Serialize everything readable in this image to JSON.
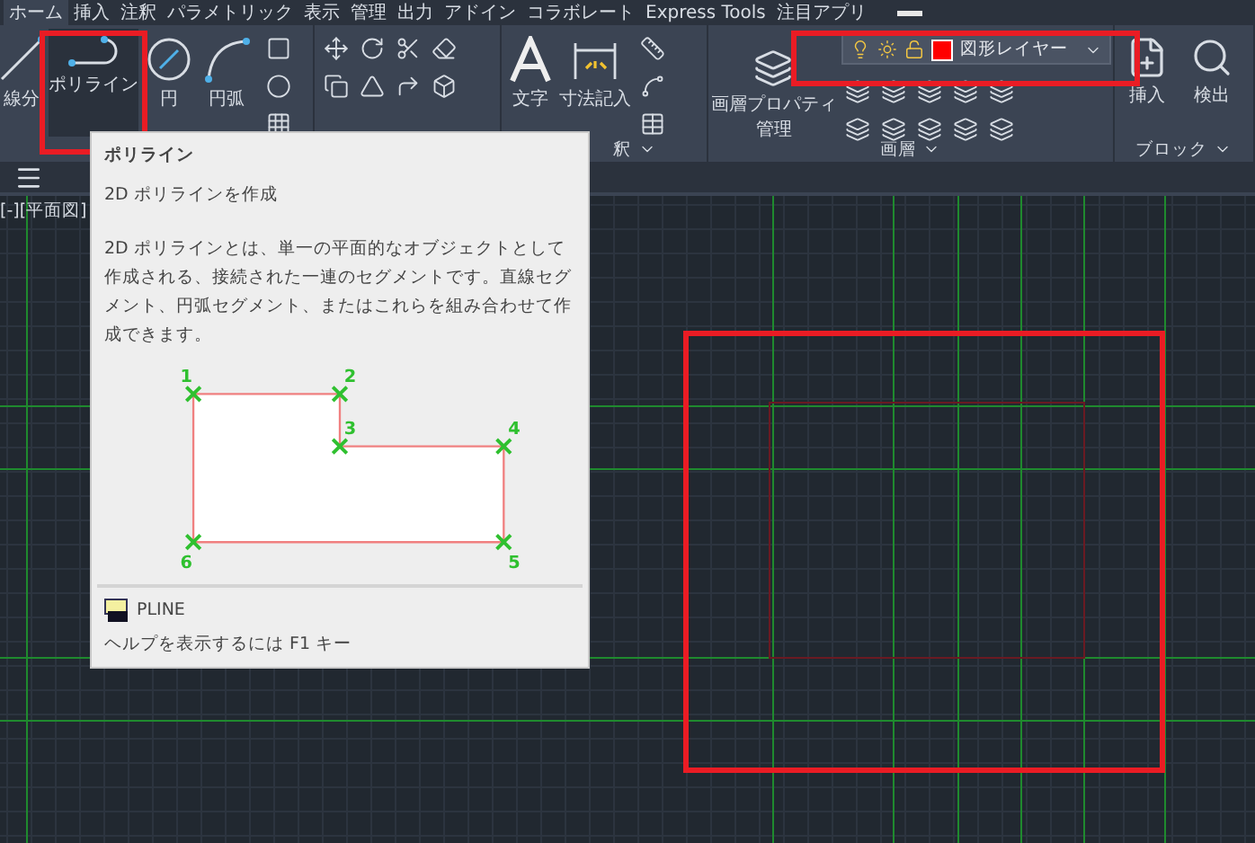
{
  "ribbon_tabs": [
    {
      "label": "ホーム",
      "selected": true
    },
    {
      "label": "挿入",
      "selected": false
    },
    {
      "label": "注釈",
      "selected": false
    },
    {
      "label": "パラメトリック",
      "selected": false
    },
    {
      "label": "表示",
      "selected": false
    },
    {
      "label": "管理",
      "selected": false
    },
    {
      "label": "出力",
      "selected": false
    },
    {
      "label": "アドイン",
      "selected": false
    },
    {
      "label": "コラボレート",
      "selected": false
    },
    {
      "label": "Express Tools",
      "selected": false
    },
    {
      "label": "注目アプリ",
      "selected": false
    }
  ],
  "draw_panel": {
    "tools": [
      {
        "label": "線分",
        "selected": false
      },
      {
        "label": "ポリライン",
        "selected": true
      },
      {
        "label": "円",
        "selected": false
      },
      {
        "label": "円弧",
        "selected": false
      }
    ]
  },
  "annotation_panel": {
    "title": "釈",
    "tools": [
      {
        "label": "文字"
      },
      {
        "label": "寸法記入"
      }
    ]
  },
  "layer_panel": {
    "title": "画層",
    "properties_button": "画層プロパティ管理",
    "current_layer": {
      "name": "図形レイヤー",
      "color": "#ff0000"
    }
  },
  "block_panel": {
    "title": "ブロック",
    "tools": [
      {
        "label": "挿入"
      },
      {
        "label": "検出"
      }
    ]
  },
  "viewport": {
    "label": "[-][平面図]"
  },
  "tooltip": {
    "title": "ポリライン",
    "summary": "2D ポリラインを作成",
    "description": "2D ポリラインとは、単一の平面的なオブジェクトとして作成される、接続された一連のセグメントです。直線セグメント、円弧セグメント、またはこれらを組み合わせて作成できます。",
    "vertices": [
      "1",
      "2",
      "3",
      "4",
      "5",
      "6"
    ],
    "command": "PLINE",
    "help": "ヘルプを表示するには F1 キー"
  }
}
